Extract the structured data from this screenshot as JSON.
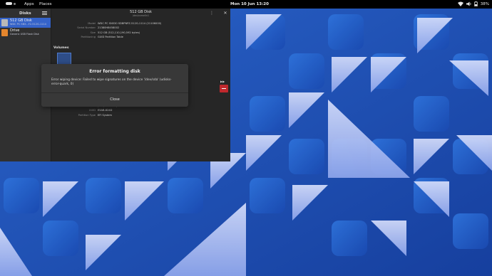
{
  "topbar": {
    "apps": "Apps",
    "places": "Places",
    "clock": "Mon 10 Jun  13:20",
    "battery": "38%"
  },
  "sidebar": {
    "title": "Disks",
    "drives": [
      {
        "name": "512 GB Disk",
        "sub": "WDC PC SN5...F2-512G-1114",
        "selected": true,
        "icon_color": "#b9b9b9"
      },
      {
        "name": "Drive",
        "sub": "Generic USB Flash Disk",
        "selected": false,
        "icon_color": "#e5862d"
      }
    ]
  },
  "main": {
    "title": "512 GB Disk",
    "subtitle": "/dev/nvme0n1",
    "properties": [
      {
        "key": "Model",
        "value": "WDC PC SN530 SDBPNPZ-512G-1114 (21106000)"
      },
      {
        "key": "Serial Number",
        "value": "21380H8458002"
      },
      {
        "key": "Size",
        "value": "512 GB (512,110,190,592 bytes)"
      },
      {
        "key": "Partitioning",
        "value": "GUID Partition Table"
      }
    ],
    "volumes_label": "Volumes",
    "lower_properties": [
      {
        "key": "Device",
        "value": "/dev/nvme0n1p1"
      },
      {
        "key": "UUID",
        "value": "E5AB-824D"
      },
      {
        "key": "Partition Type",
        "value": "EFI System"
      }
    ]
  },
  "dialog": {
    "title": "Error formatting disk",
    "message": "Error wiping device: Failed to wipe signatures on the device '/dev/sda' (udisks-error-quark, 0)",
    "close_label": "Close"
  },
  "colors": {
    "accent": "#3563c9",
    "wallpaper": "#1e4fb8",
    "stop_button": "#c0282d"
  }
}
